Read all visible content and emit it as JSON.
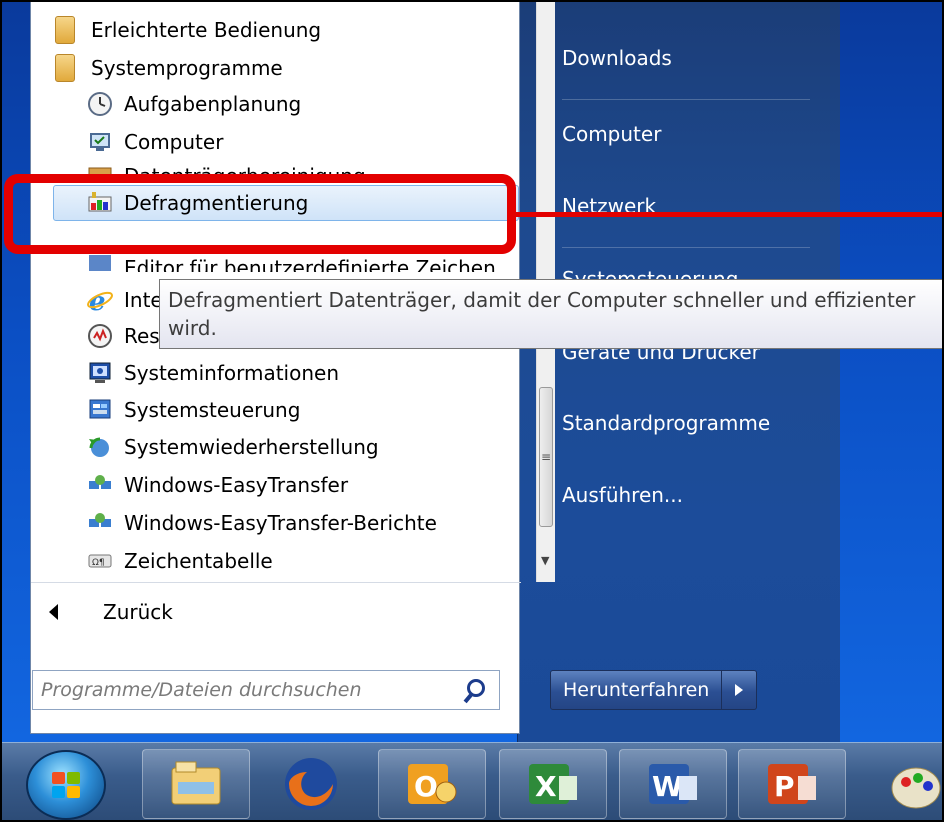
{
  "programs": {
    "folders": [
      {
        "label": "Erleichterte Bedienung"
      },
      {
        "label": "Systemprogramme"
      }
    ],
    "items": [
      {
        "label": "Aufgabenplanung",
        "icon": "clock-icon"
      },
      {
        "label": "Computer",
        "icon": "computer-icon"
      },
      {
        "label": "Datenträgerbereinigung",
        "icon": "disk-cleanup-icon"
      },
      {
        "label": "Defragmentierung",
        "icon": "defrag-icon"
      },
      {
        "label": "Editor für benutzerdefinierte Zeichen",
        "icon": "editor-icon"
      },
      {
        "label": "Internet Explorer",
        "icon": "ie-icon"
      },
      {
        "label": "Ressourcenmonitor",
        "icon": "resource-monitor-icon"
      },
      {
        "label": "Systeminformationen",
        "icon": "sysinfo-icon"
      },
      {
        "label": "Systemsteuerung",
        "icon": "control-panel-icon"
      },
      {
        "label": "Systemwiederherstellung",
        "icon": "restore-icon"
      },
      {
        "label": "Windows-EasyTransfer",
        "icon": "easytransfer-icon"
      },
      {
        "label": "Windows-EasyTransfer-Berichte",
        "icon": "easytransfer-reports-icon"
      },
      {
        "label": "Zeichentabelle",
        "icon": "charmap-icon"
      }
    ],
    "back_label": "Zurück"
  },
  "tooltip": {
    "line1": "Defragmentiert Datenträger, damit der Computer schneller und effizienter",
    "line2": "wird."
  },
  "search": {
    "placeholder": "Programme/Dateien durchsuchen"
  },
  "right_links": [
    {
      "label": "Downloads"
    },
    {
      "label": "Computer"
    },
    {
      "label": "Netzwerk"
    },
    {
      "label": "Systemsteuerung"
    },
    {
      "label": "Geräte und Drucker"
    },
    {
      "label": "Standardprogramme"
    },
    {
      "label": "Ausführen..."
    }
  ],
  "shutdown": {
    "label": "Herunterfahren"
  },
  "taskbar": {
    "apps": [
      "explorer-icon",
      "firefox-icon",
      "outlook-icon",
      "excel-icon",
      "word-icon",
      "powerpoint-icon",
      "paint-icon"
    ]
  },
  "colors": {
    "highlight": "#e30000",
    "start_panel": "#1e4a8f",
    "taskbar": "#3a5c8b"
  }
}
